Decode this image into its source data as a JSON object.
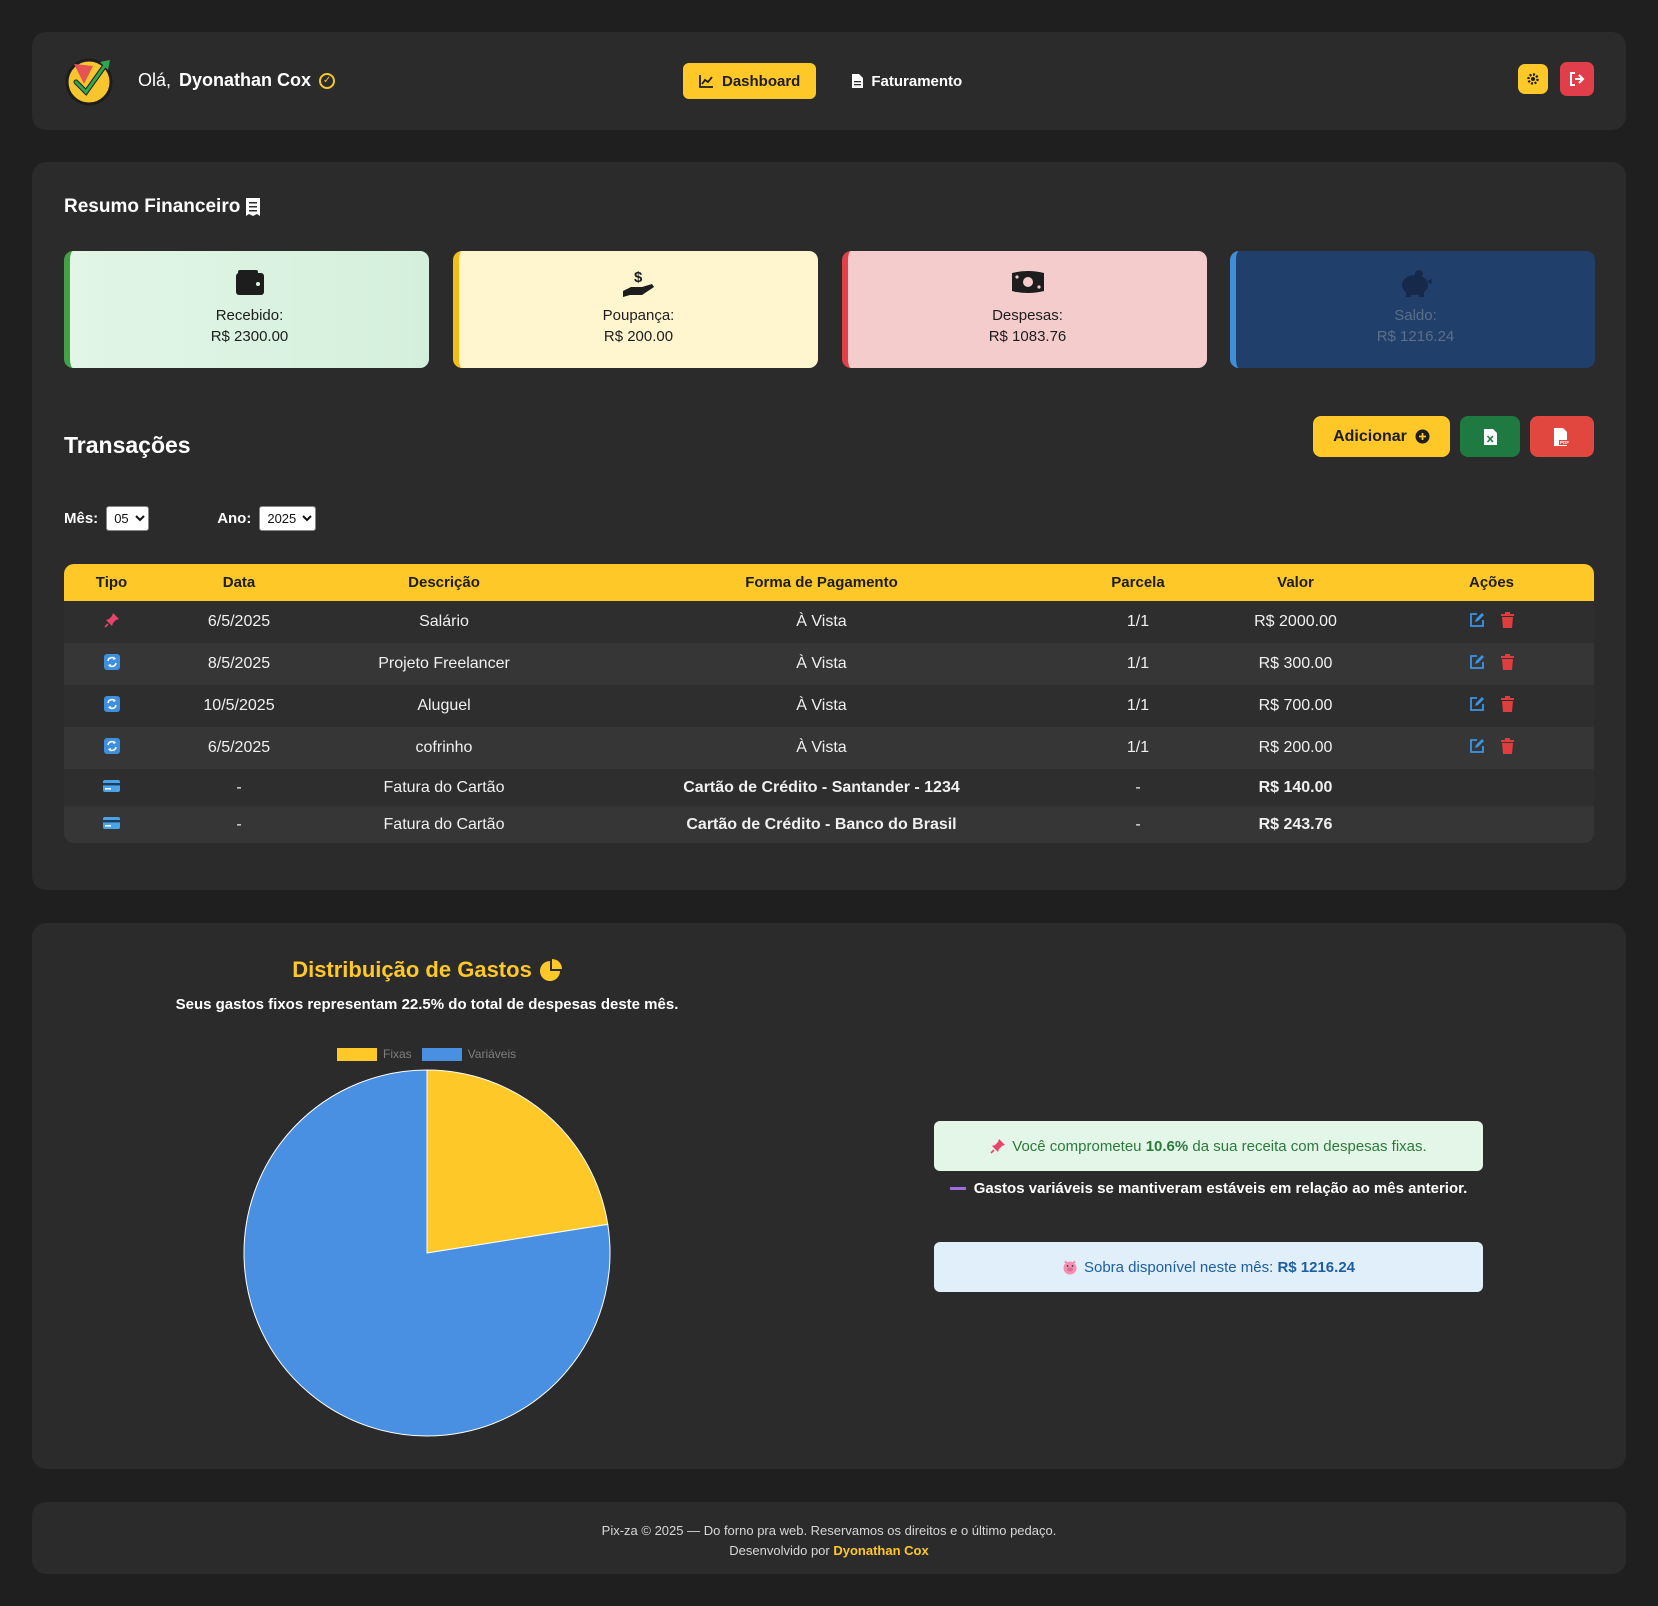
{
  "header": {
    "greeting": "Olá,",
    "user_name": "Dyonathan Cox",
    "nav": [
      {
        "label": "Dashboard",
        "icon": "chart-line-icon",
        "active": true
      },
      {
        "label": "Faturamento",
        "icon": "file-icon",
        "active": false
      }
    ],
    "settings_icon": "gear-icon",
    "logout_icon": "logout-icon"
  },
  "summary": {
    "title": "Resumo Financeiro",
    "cards": [
      {
        "label": "Recebido:",
        "value": "R$ 2300.00",
        "icon": "wallet-icon",
        "color": "#43a047"
      },
      {
        "label": "Poupança:",
        "value": "R$ 200.00",
        "icon": "hand-dollar-icon",
        "color": "#f5bd19"
      },
      {
        "label": "Despesas:",
        "value": "R$ 1083.76",
        "icon": "money-bill-icon",
        "color": "#e14048"
      },
      {
        "label": "Saldo:",
        "value": "R$ 1216.24",
        "icon": "piggy-bank-icon",
        "color": "#3f8fd8"
      }
    ]
  },
  "transactions": {
    "title": "Transações",
    "add_label": "Adicionar",
    "filters": {
      "month_label": "Mês:",
      "month_value": "05",
      "year_label": "Ano:",
      "year_value": "2025"
    },
    "columns": [
      "Tipo",
      "Data",
      "Descrição",
      "Forma de Pagamento",
      "Parcela",
      "Valor",
      "Ações"
    ],
    "rows": [
      {
        "tipo": "pin-icon",
        "data": "6/5/2025",
        "descricao": "Salário",
        "forma": "À Vista",
        "parcela": "1/1",
        "valor": "R$ 2000.00"
      },
      {
        "tipo": "repeat-icon",
        "data": "8/5/2025",
        "descricao": "Projeto Freelancer",
        "forma": "À Vista",
        "parcela": "1/1",
        "valor": "R$ 300.00"
      },
      {
        "tipo": "repeat-icon",
        "data": "10/5/2025",
        "descricao": "Aluguel",
        "forma": "À Vista",
        "parcela": "1/1",
        "valor": "R$ 700.00"
      },
      {
        "tipo": "repeat-icon",
        "data": "6/5/2025",
        "descricao": "cofrinho",
        "forma": "À Vista",
        "parcela": "1/1",
        "valor": "R$ 200.00"
      },
      {
        "tipo": "card-icon",
        "data": "-",
        "descricao": "Fatura do Cartão",
        "forma": "Cartão de Crédito - Santander - 1234",
        "parcela": "-",
        "valor": "R$ 140.00"
      },
      {
        "tipo": "card-icon",
        "data": "-",
        "descricao": "Fatura do Cartão",
        "forma": "Cartão de Crédito - Banco do Brasil",
        "parcela": "-",
        "valor": "R$ 243.76"
      }
    ]
  },
  "distribution": {
    "title": "Distribuição de Gastos",
    "subtitle_prefix": "Seus gastos fixos representam ",
    "subtitle_pct": "22.5%",
    "subtitle_suffix": " do total de despesas deste mês.",
    "insight_fixed_prefix": "Você comprometeu ",
    "insight_fixed_pct": "10.6%",
    "insight_fixed_suffix": " da sua receita com despesas fixas.",
    "insight_variable": "Gastos variáveis se mantiveram estáveis em relação ao mês anterior.",
    "insight_leftover_prefix": "Sobra disponível neste mês: ",
    "insight_leftover_value": "R$ 1216.24"
  },
  "chart_data": {
    "type": "pie",
    "title": "",
    "categories": [
      "Fixas",
      "Variáveis"
    ],
    "values": [
      22.5,
      77.5
    ],
    "colors": [
      "#fec928",
      "#4a90e2"
    ],
    "legend": "top"
  },
  "footer": {
    "line1": "Pix-za © 2025 — Do forno pra web. Reservamos os direitos e o último pedaço.",
    "dev_prefix": "Desenvolvido por ",
    "dev_name": "Dyonathan Cox"
  }
}
